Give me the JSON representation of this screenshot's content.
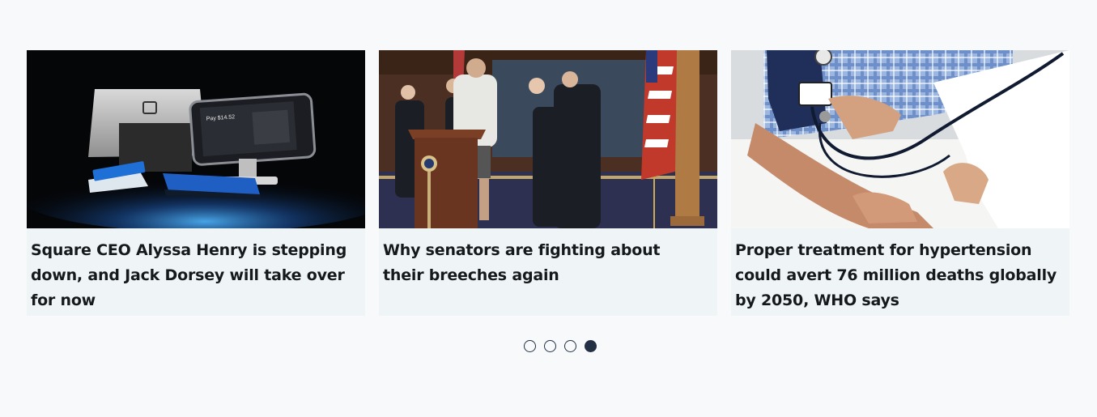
{
  "carousel": {
    "cards": [
      {
        "title": "Square CEO Alyssa Henry is stepping down, and Jack Dorsey will take over for now",
        "image": "square-pos-terminals-photo",
        "image_screen_text": "Pay $14.52"
      },
      {
        "title": "Why senators are fighting about their breeches again",
        "image": "senators-press-conference-photo"
      },
      {
        "title": "Proper treatment for hypertension could avert 76 million deaths globally by 2050, WHO says",
        "image": "blood-pressure-check-photo"
      }
    ],
    "pagination": {
      "count": 4,
      "active_index": 3
    }
  }
}
